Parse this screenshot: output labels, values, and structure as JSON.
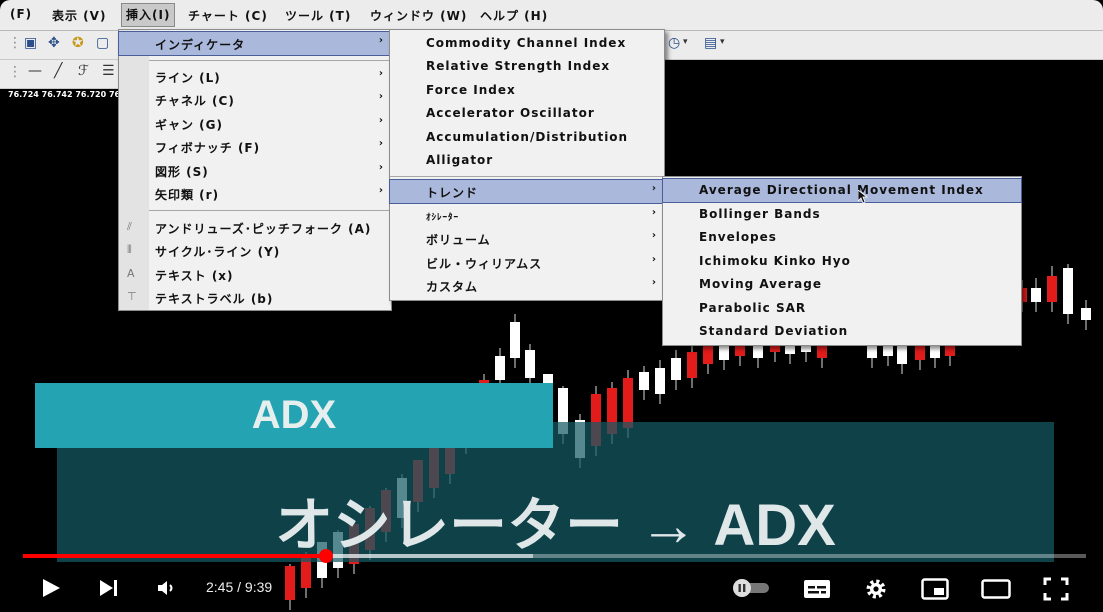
{
  "menubar": [
    "(F)",
    "表示 (V)",
    "挿入(I)",
    "チャート (C)",
    "ツール (T)",
    "ウィンドウ (W)",
    "ヘルプ (H)"
  ],
  "price_labels": "76.724 76.742 76.720 76",
  "insert_menu": {
    "items": [
      {
        "label": "インディケータ",
        "arrow": "›"
      },
      {
        "label": "ライン (L)",
        "arrow": "›"
      },
      {
        "label": "チャネル (C)",
        "arrow": "›"
      },
      {
        "label": "ギャン (G)",
        "arrow": "›"
      },
      {
        "label": "フィボナッチ (F)",
        "arrow": "›"
      },
      {
        "label": "図形 (S)",
        "arrow": "›"
      },
      {
        "label": "矢印類 (r)",
        "arrow": "›"
      },
      {
        "label": "アンドリューズ･ピッチフォーク (A)",
        "arrow": ""
      },
      {
        "label": "サイクル･ライン (Y)",
        "arrow": ""
      },
      {
        "label": "テキスト (x)",
        "arrow": ""
      },
      {
        "label": "テキストラベル (b)",
        "arrow": ""
      }
    ]
  },
  "indicator_menu": {
    "items": [
      {
        "label": "Commodity Channel Index",
        "arrow": ""
      },
      {
        "label": "Relative Strength Index",
        "arrow": ""
      },
      {
        "label": "Force Index",
        "arrow": ""
      },
      {
        "label": "Accelerator Oscillator",
        "arrow": ""
      },
      {
        "label": "Accumulation/Distribution",
        "arrow": ""
      },
      {
        "label": "Alligator",
        "arrow": ""
      },
      {
        "label": "トレンド",
        "arrow": "›"
      },
      {
        "label": "ｵｼﾚｰﾀｰ",
        "arrow": "›"
      },
      {
        "label": "ボリューム",
        "arrow": "›"
      },
      {
        "label": "ビル・ウィリアムス",
        "arrow": "›"
      },
      {
        "label": "カスタム",
        "arrow": "›"
      }
    ]
  },
  "trend_menu": {
    "items": [
      "Average Directional Movement Index",
      "Bollinger Bands",
      "Envelopes",
      "Ichimoku Kinko Hyo",
      "Moving Average",
      "Parabolic SAR",
      "Standard Deviation"
    ]
  },
  "overlay": {
    "title": "ADX",
    "subtitle": "オシレーター → ADX"
  },
  "player": {
    "time": "2:45 / 9:39",
    "progress": 0.285,
    "buffered": 0.48,
    "accent": "#ff0000"
  }
}
